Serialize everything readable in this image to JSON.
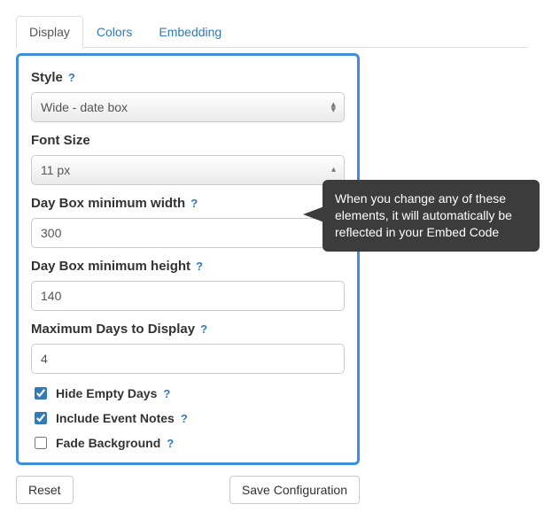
{
  "tabs": {
    "display": "Display",
    "colors": "Colors",
    "embedding": "Embedding"
  },
  "form": {
    "style": {
      "label": "Style",
      "value": "Wide - date box"
    },
    "fontSize": {
      "label": "Font Size",
      "value": "11 px"
    },
    "minWidth": {
      "label": "Day Box minimum width",
      "value": "300"
    },
    "minHeight": {
      "label": "Day Box minimum height",
      "value": "140"
    },
    "maxDays": {
      "label": "Maximum Days to Display",
      "value": "4"
    },
    "hideEmpty": {
      "label": "Hide Empty Days",
      "checked": true
    },
    "includeNotes": {
      "label": "Include Event Notes",
      "checked": true
    },
    "fadeBg": {
      "label": "Fade Background",
      "checked": false
    }
  },
  "help": "?",
  "buttons": {
    "reset": "Reset",
    "save": "Save Configuration"
  },
  "tooltip": "When you change any of these elements, it will automatically be reflected in your Embed Code"
}
